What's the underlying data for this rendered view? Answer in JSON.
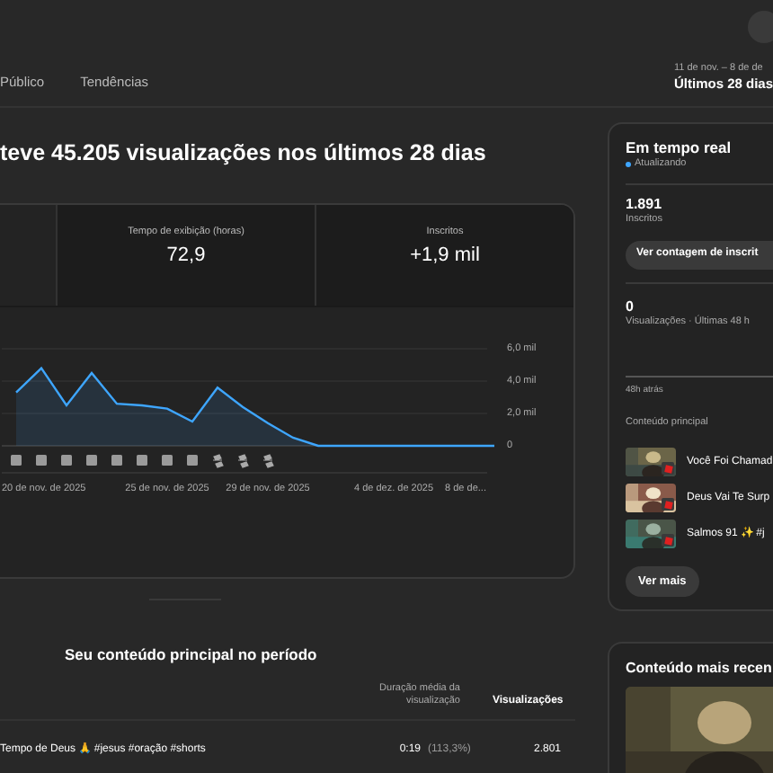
{
  "header": {
    "tabs": [
      {
        "label": "Público",
        "selected": false
      },
      {
        "label": "Tendências",
        "selected": false
      }
    ],
    "date_range": "11 de nov. – 8 de de",
    "period": "Últimos 28 dias"
  },
  "title": "teve 45.205 visualizações nos últimos 28 dias",
  "metrics": [
    {
      "label": "Tempo de exibição (horas)",
      "value": "72,9"
    },
    {
      "label": "Inscritos",
      "value": "+1,9 mil"
    }
  ],
  "chart_data": {
    "type": "area",
    "categories": [
      null,
      "20 de nov. de 2025",
      null,
      null,
      null,
      null,
      "25 de nov. de 2025",
      null,
      null,
      null,
      "29 de nov. de 2025",
      null,
      null,
      null,
      null,
      "4 de dez. de 2025",
      null,
      null,
      null,
      "8 de de..."
    ],
    "series": [
      {
        "color": "#3ea6ff",
        "values": [
          3.3,
          4.8,
          2.5,
          4.5,
          2.6,
          2.5,
          2.3,
          1.5,
          3.6,
          2.4,
          1.4,
          0.5,
          0,
          0,
          0,
          0,
          0,
          0,
          0,
          0
        ]
      }
    ],
    "ylim": [
      0,
      6
    ],
    "yticks": [
      {
        "value": 0,
        "label": "0"
      },
      {
        "value": 2,
        "label": "2,0 mil"
      },
      {
        "value": 4,
        "label": "4,0 mil"
      },
      {
        "value": 6,
        "label": "6,0 mil"
      }
    ]
  },
  "top_content": {
    "title": "Seu conteúdo principal no período",
    "columns": [
      "Duração média da visualização",
      "Visualizações"
    ],
    "rows": [
      {
        "title": "Tempo de Deus 🙏 #jesus #oração #shorts",
        "avg_duration": "0:19",
        "avg_percent": "(113,3%)",
        "views": "2.801"
      }
    ]
  },
  "realtime": {
    "title": "Em tempo real",
    "status": "Atualizando",
    "subscribers": "1.891",
    "subscribers_label": "Inscritos",
    "count_button": "Ver contagem de inscrit",
    "views": "0",
    "views_label": "Visualizações · Últimas 48 h",
    "ago": "48h atrás",
    "content_heading": "Conteúdo principal",
    "items": [
      {
        "title": "Você Foi Chamad"
      },
      {
        "title": "Deus Vai Te Surp"
      },
      {
        "title": "Salmos 91 ✨ #j"
      }
    ],
    "more_button": "Ver mais"
  },
  "recent": {
    "title": "Conteúdo mais recen"
  }
}
